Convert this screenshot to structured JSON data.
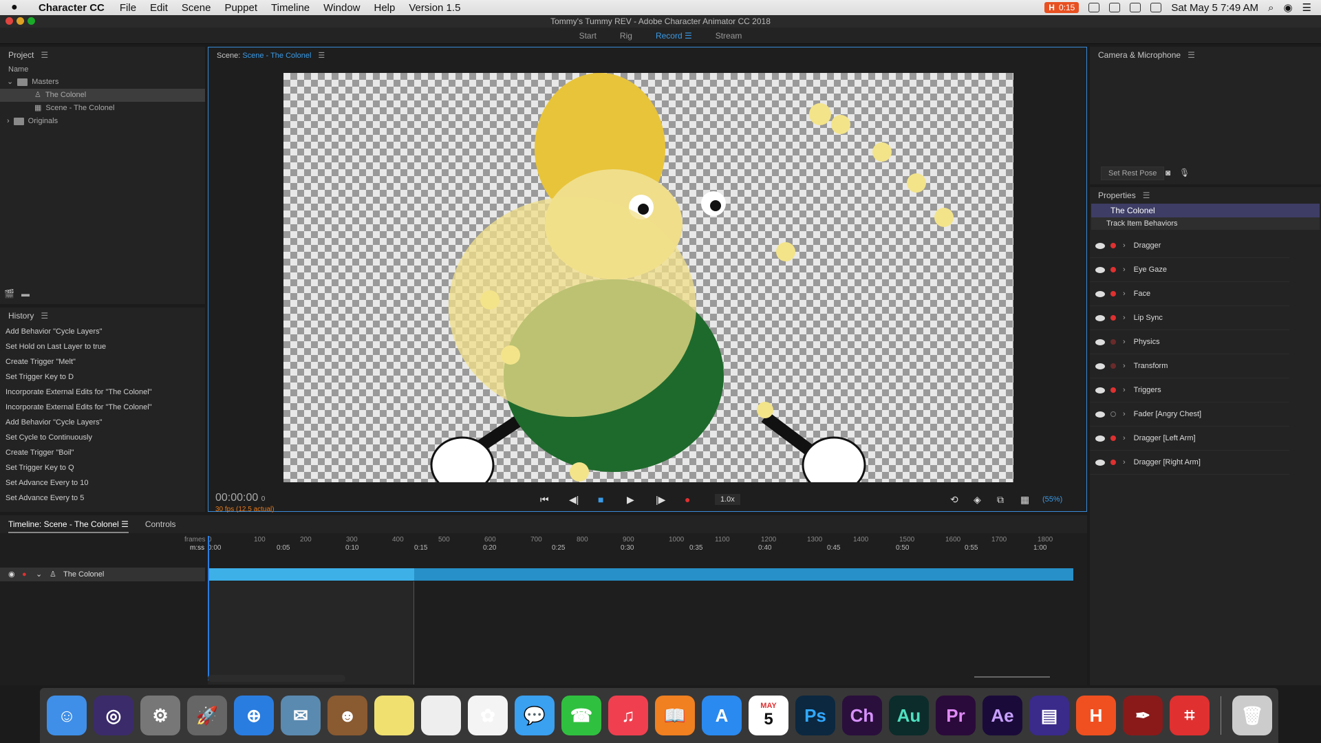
{
  "menubar": {
    "app": "Character CC",
    "items": [
      "File",
      "Edit",
      "Scene",
      "Puppet",
      "Timeline",
      "Window",
      "Help",
      "Version 1.5"
    ],
    "timer": "0:15",
    "datetime": "Sat May 5  7:49 AM"
  },
  "window_title": "Tommy's Tummy REV - Adobe Character Animator CC 2018",
  "workspace_tabs": [
    "Start",
    "Rig",
    "Record",
    "Stream"
  ],
  "project": {
    "title": "Project",
    "col": "Name",
    "items": [
      {
        "label": "Masters"
      },
      {
        "label": "The Colonel"
      },
      {
        "label": "Scene - The Colonel"
      },
      {
        "label": "Originals"
      }
    ]
  },
  "history": {
    "title": "History",
    "items": [
      "Add Behavior \"Cycle Layers\"",
      "Set Hold on Last Layer to true",
      "Create Trigger \"Melt\"",
      "Set Trigger Key to D",
      "Incorporate External Edits for \"The Colonel\"",
      "Incorporate External Edits for \"The Colonel\"",
      "Add Behavior \"Cycle Layers\"",
      "Set Cycle to Continuously",
      "Create Trigger \"Boil\"",
      "Set Trigger Key to Q",
      "Set Advance Every to 10",
      "Set Advance Every to 5"
    ]
  },
  "scene": {
    "prefix": "Scene:",
    "name": "Scene - The Colonel",
    "timecode": "00:00:00",
    "frame": "0",
    "fps": "30 fps (12.5 actual)",
    "speed": "1.0x",
    "zoom": "(55%)"
  },
  "camera": {
    "title": "Camera & Microphone",
    "rest_pose": "Set Rest Pose"
  },
  "properties": {
    "title": "Properties",
    "puppet": "The Colonel",
    "section": "Track Item Behaviors",
    "behaviors": [
      "Dragger",
      "Eye Gaze",
      "Face",
      "Lip Sync",
      "Physics",
      "Transform",
      "Triggers",
      "Fader [Angry Chest]",
      "Dragger [Left Arm]",
      "Dragger [Right Arm]"
    ]
  },
  "timeline": {
    "tab": "Timeline: Scene - The Colonel",
    "controls": "Controls",
    "frames_label": "frames",
    "mss_label": "m:ss",
    "frame_ticks": [
      "0",
      "100",
      "200",
      "300",
      "400",
      "500",
      "600",
      "700",
      "800",
      "900",
      "1000",
      "1100",
      "1200",
      "1300",
      "1400",
      "1500",
      "1600",
      "1700",
      "1800"
    ],
    "time_ticks": [
      "0:00",
      "0:05",
      "0:10",
      "0:15",
      "0:20",
      "0:25",
      "0:30",
      "0:35",
      "0:40",
      "0:45",
      "0:50",
      "0:55",
      "1:00"
    ],
    "layer": "The Colonel"
  },
  "dock": {
    "apps": [
      "Ps",
      "Ch",
      "Au",
      "Pr",
      "Ae",
      "H"
    ],
    "calendar_month": "MAY",
    "calendar_day": "5"
  },
  "colors": {
    "accent": "#3a9be8",
    "record": "#e03030",
    "timeline_bar": "#3db0e8"
  }
}
